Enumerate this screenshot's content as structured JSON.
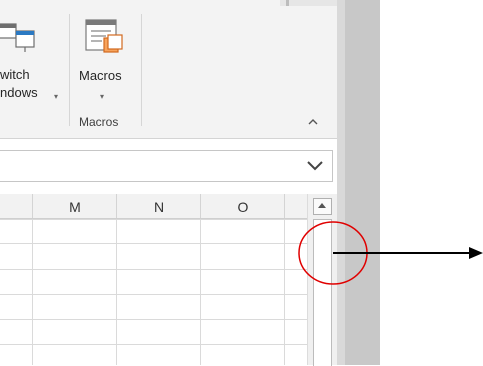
{
  "ribbon": {
    "switch_windows": {
      "label_line1": "witch",
      "label_line2": "ndows",
      "caret": "▾",
      "icon": "switch-windows-icon"
    },
    "macros": {
      "label": "Macros",
      "caret": "▾",
      "icon": "macros-icon"
    },
    "group_label": "Macros",
    "collapse_glyph": "⌃"
  },
  "formula_bar": {
    "value": "",
    "expand_glyph": "chevron-down-icon"
  },
  "grid": {
    "columns": [
      "M",
      "N",
      "O"
    ],
    "row_count": 6
  },
  "colors": {
    "ribbon_bg": "#f3f3f3",
    "annotation_red": "#e00000",
    "arrow": "#000000"
  }
}
